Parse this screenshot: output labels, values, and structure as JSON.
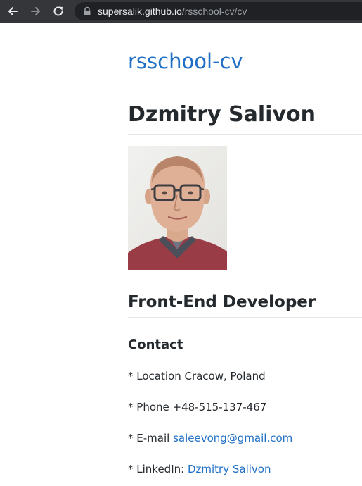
{
  "browser": {
    "url_host": "supersalik.github.io",
    "url_path": "/rsschool-cv/cv"
  },
  "page": {
    "site_title": "rsschool-cv",
    "name": "Dzmitry Salivon",
    "role": "Front-End Developer",
    "contact_heading": "Contact",
    "contacts": [
      {
        "prefix": "* Location Cracow, Poland",
        "link": ""
      },
      {
        "prefix": "* Phone +48-515-137-467",
        "link": ""
      },
      {
        "prefix": "* E-mail ",
        "link": "saleevong@gmail.com"
      },
      {
        "prefix": "* LinkedIn: ",
        "link": "Dzmitry Salivon"
      }
    ]
  },
  "colors": {
    "toolbar": "#35363a",
    "omnibox": "#202124",
    "link": "#1f6fc5",
    "text": "#24292e"
  }
}
